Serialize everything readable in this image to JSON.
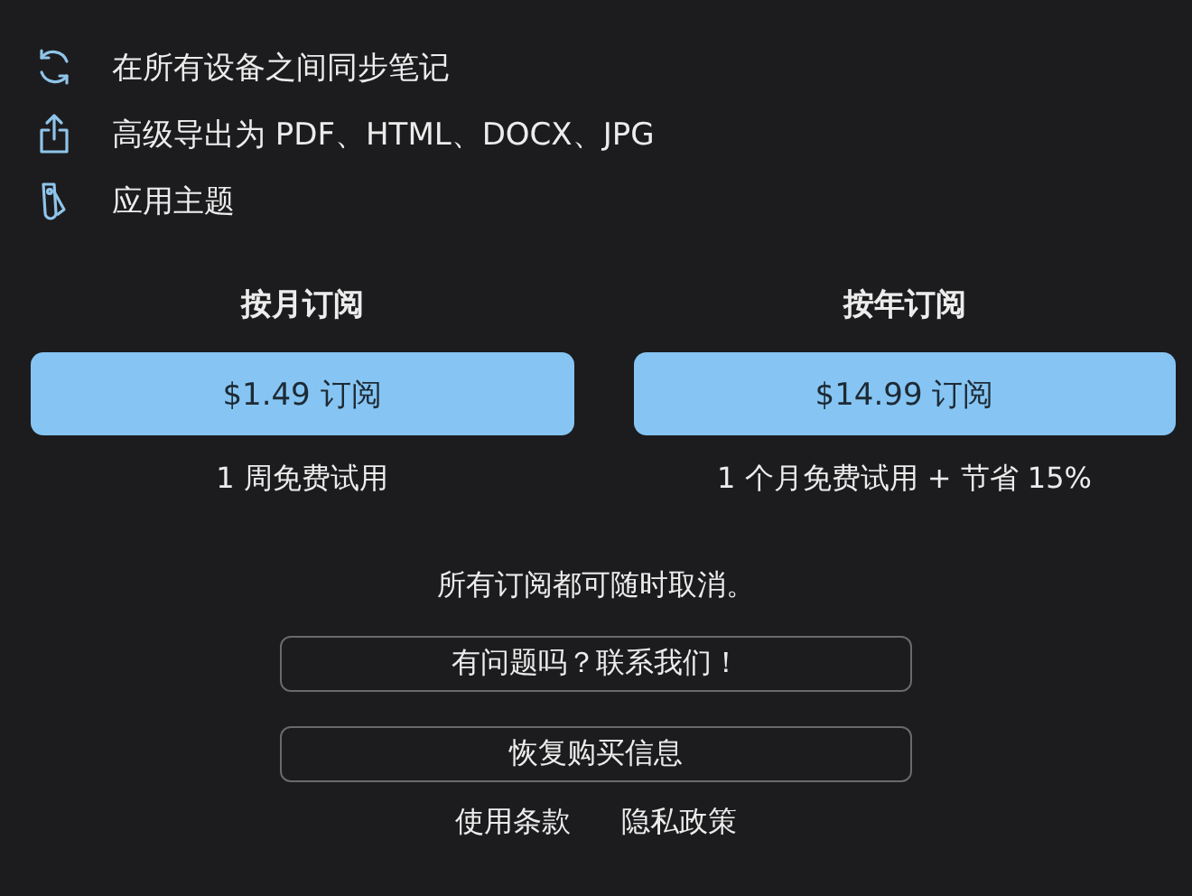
{
  "features": [
    {
      "text": "在所有设备之间同步笔记"
    },
    {
      "text": "高级导出为 PDF、HTML、DOCX、JPG"
    },
    {
      "text": "应用主题"
    }
  ],
  "plans": [
    {
      "title": "按月订阅",
      "button": "$1.49 订阅",
      "note": "1 周免费试用"
    },
    {
      "title": "按年订阅",
      "button": "$14.99 订阅",
      "note": "1 个月免费试用 + 节省 15%"
    }
  ],
  "cancel_note": "所有订阅都可随时取消。",
  "actions": [
    "有问题吗？联系我们！",
    "恢复购买信息"
  ],
  "links": [
    "使用条款",
    "隐私政策"
  ]
}
